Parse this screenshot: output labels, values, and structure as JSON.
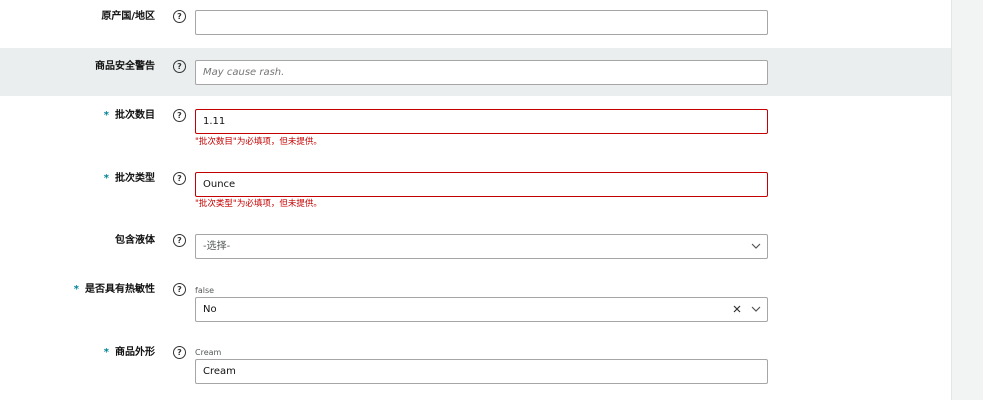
{
  "fields": {
    "origin": {
      "label": "原产国/地区",
      "value": ""
    },
    "safety_warning": {
      "label": "商品安全警告",
      "placeholder": "May cause rash.",
      "value": ""
    },
    "batch_count": {
      "required_mark": "*",
      "label": "批次数目",
      "value": "1.11",
      "error": "\"批次数目\"为必填项，但未提供。"
    },
    "batch_type": {
      "required_mark": "*",
      "label": "批次类型",
      "value": "Ounce",
      "error": "\"批次类型\"为必填项，但未提供。"
    },
    "contains_liquid": {
      "label": "包含液体",
      "selected": "-选择-"
    },
    "heat_sensitive": {
      "required_mark": "*",
      "label": "是否具有热敏性",
      "hint": "false",
      "selected": "No"
    },
    "item_form": {
      "required_mark": "*",
      "label": "商品外形",
      "hint": "Cream",
      "value": "Cream"
    }
  },
  "icons": {
    "help": "question-circle-icon",
    "dropdown": "chevron-down-icon",
    "clear": "close-icon"
  },
  "help_glyph": "?",
  "colors": {
    "error": "#c40000",
    "required": "#008296",
    "band": "#ebeeee"
  }
}
